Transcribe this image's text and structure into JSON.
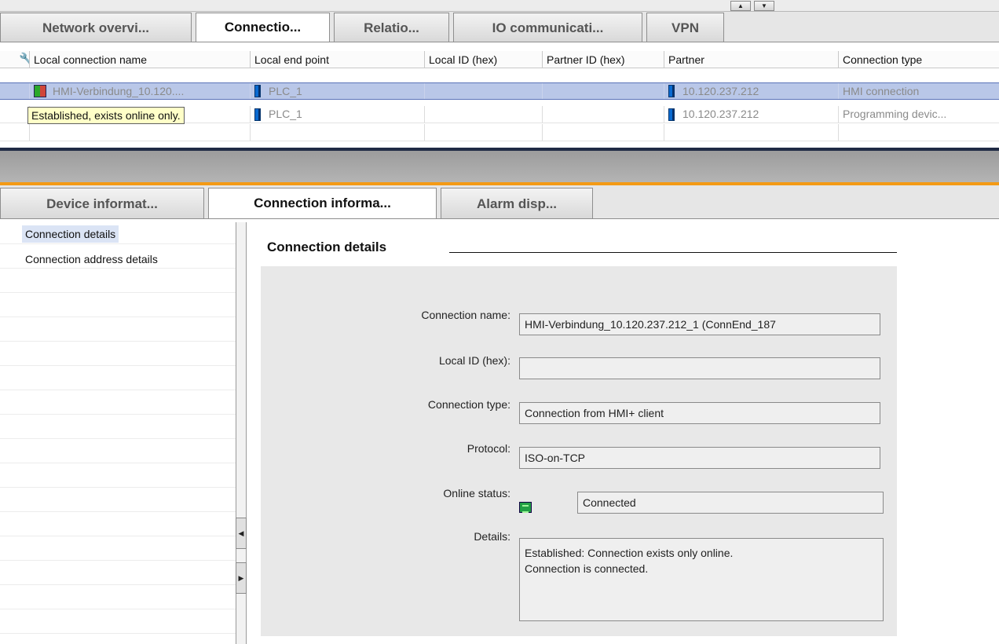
{
  "top_tabs": [
    {
      "label": "Network overvi...",
      "active": false
    },
    {
      "label": "Connectio...",
      "active": true
    },
    {
      "label": "Relatio...",
      "active": false
    },
    {
      "label": "IO communicati...",
      "active": false
    },
    {
      "label": "VPN",
      "active": false
    }
  ],
  "table": {
    "columns": [
      "Local connection name",
      "Local end point",
      "Local ID (hex)",
      "Partner ID (hex)",
      "Partner",
      "Connection type"
    ],
    "rows": [
      {
        "name": "HMI-Verbindung_10.120....",
        "end_point": "PLC_1",
        "local_id": "",
        "partner_id": "",
        "partner": "10.120.237.212",
        "type": "HMI connection"
      },
      {
        "name": "",
        "end_point": "PLC_1",
        "local_id": "",
        "partner_id": "",
        "partner": "10.120.237.212",
        "type": "Programming devic..."
      }
    ],
    "tooltip": "Established, exists online only."
  },
  "bottom_tabs": [
    {
      "label": "Device informat...",
      "active": false
    },
    {
      "label": "Connection informa...",
      "active": true
    },
    {
      "label": "Alarm disp...",
      "active": false
    }
  ],
  "nav": {
    "items": [
      {
        "label": "Connection details",
        "selected": true
      },
      {
        "label": "Connection address details",
        "selected": false
      }
    ]
  },
  "details": {
    "title": "Connection details",
    "connection_name_label": "Connection name:",
    "connection_name_value": "HMI-Verbindung_10.120.237.212_1 (ConnEnd_187",
    "local_id_label": "Local ID (hex):",
    "local_id_value": "",
    "connection_type_label": "Connection type:",
    "connection_type_value": "Connection from HMI+ client",
    "protocol_label": "Protocol:",
    "protocol_value": "ISO-on-TCP",
    "online_status_label": "Online status:",
    "online_status_value": "Connected",
    "details_label": "Details:",
    "details_line1": "Established: Connection exists only online.",
    "details_line2": "Connection is connected."
  },
  "colors": {
    "selection": "#b9c7e8",
    "accent_orange": "#f39a15",
    "tooltip_bg": "#ffffc8"
  }
}
